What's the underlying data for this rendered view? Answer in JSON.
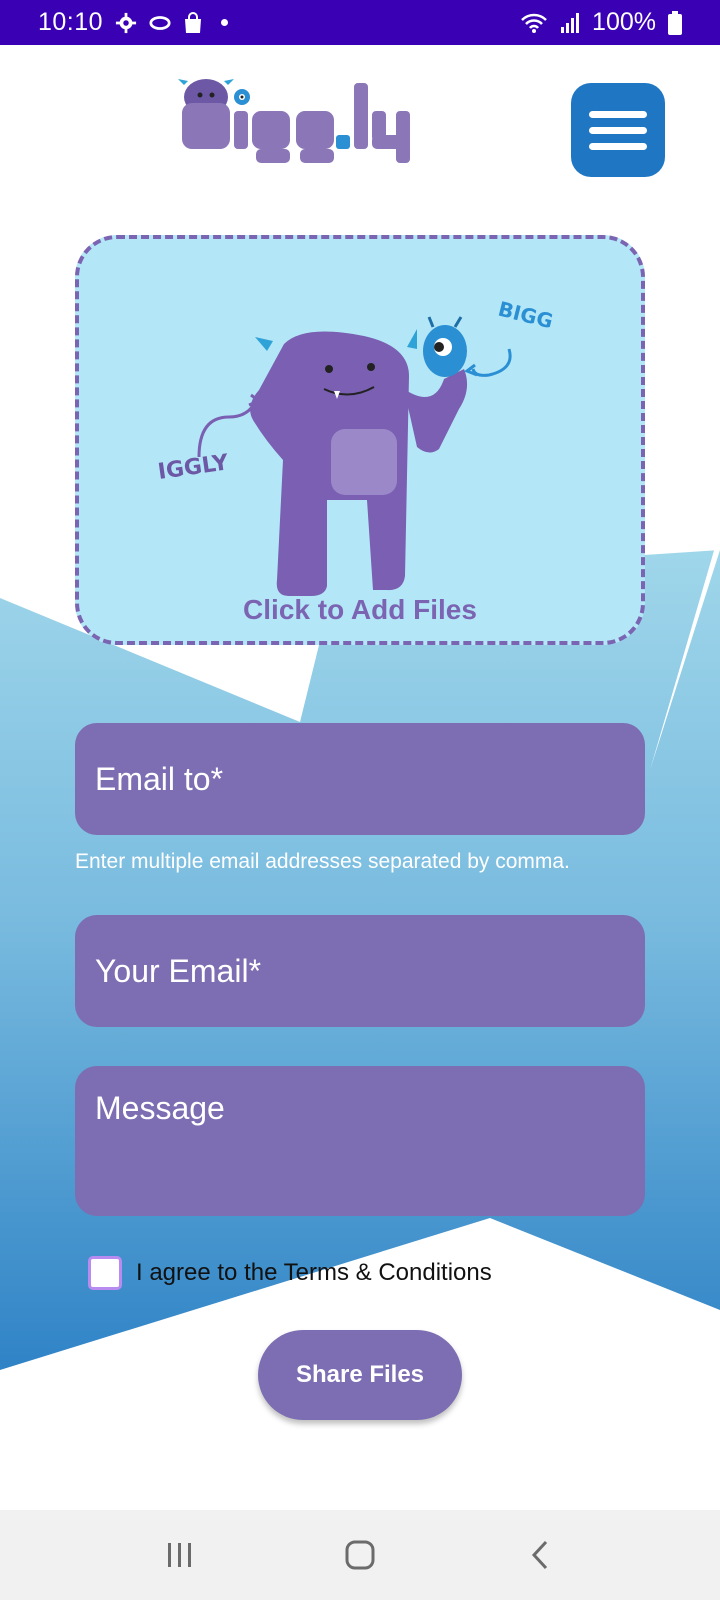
{
  "status_bar": {
    "time": "10:10",
    "battery": "100%",
    "icons": [
      "settings-icon",
      "sync-icon",
      "shopping-bag-icon",
      "dot-icon",
      "wifi-icon",
      "signal-icon",
      "battery-icon"
    ]
  },
  "header": {
    "logo_text": "Bigg.ly",
    "menu_icon": "hamburger-menu-icon"
  },
  "upload": {
    "label": "Click to Add Files",
    "art_text_left": "IGGLY",
    "art_text_right": "BIGG"
  },
  "form": {
    "email_to_placeholder": "Email to*",
    "hint": "Enter multiple email addresses separated by comma.",
    "your_email_placeholder": "Your Email*",
    "message_placeholder": "Message",
    "terms_label": "I agree to the Terms & Conditions",
    "submit_label": "Share Files"
  },
  "colors": {
    "status_bar": "#3a00b4",
    "brand_purple": "#7d6db2",
    "menu_blue": "#1f77c4",
    "upload_bg": "#b3e7f7"
  },
  "nav_bar": {
    "icons": [
      "recent-apps-icon",
      "home-icon",
      "back-icon"
    ]
  }
}
